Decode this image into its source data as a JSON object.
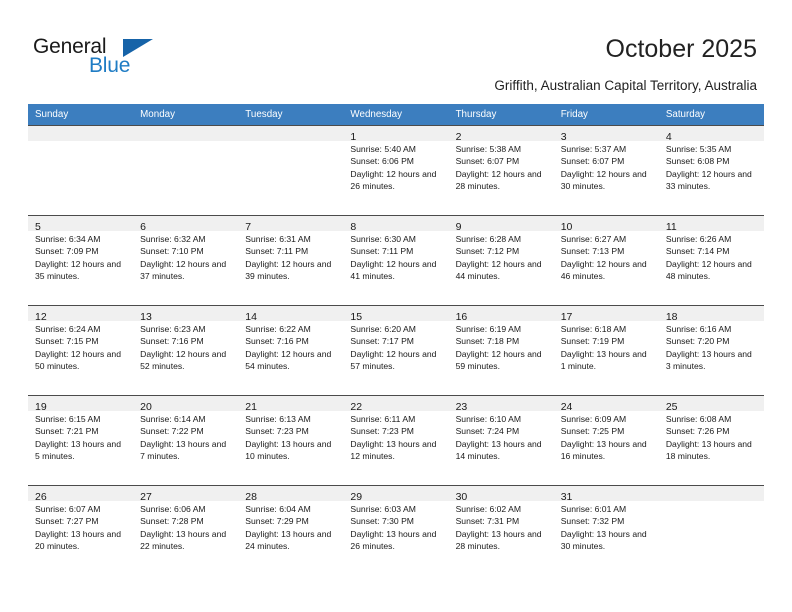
{
  "logo": {
    "line1": "General",
    "line2": "Blue",
    "triangle_icon": "blue-triangle-icon",
    "brand_color": "#1f7cc4",
    "triangle_color": "#1663a8"
  },
  "header": {
    "title": "October 2025",
    "subtitle": "Griffith, Australian Capital Territory, Australia"
  },
  "calendar": {
    "header_background": "#3c7ebf",
    "weekday_headers": [
      "Sunday",
      "Monday",
      "Tuesday",
      "Wednesday",
      "Thursday",
      "Friday",
      "Saturday"
    ],
    "weeks": [
      [
        {
          "day": "",
          "sunrise": "",
          "sunset": "",
          "daylight": "",
          "empty": true
        },
        {
          "day": "",
          "sunrise": "",
          "sunset": "",
          "daylight": "",
          "empty": true
        },
        {
          "day": "",
          "sunrise": "",
          "sunset": "",
          "daylight": "",
          "empty": true
        },
        {
          "day": "1",
          "sunrise": "Sunrise: 5:40 AM",
          "sunset": "Sunset: 6:06 PM",
          "daylight": "Daylight: 12 hours and 26 minutes.",
          "empty": false
        },
        {
          "day": "2",
          "sunrise": "Sunrise: 5:38 AM",
          "sunset": "Sunset: 6:07 PM",
          "daylight": "Daylight: 12 hours and 28 minutes.",
          "empty": false
        },
        {
          "day": "3",
          "sunrise": "Sunrise: 5:37 AM",
          "sunset": "Sunset: 6:07 PM",
          "daylight": "Daylight: 12 hours and 30 minutes.",
          "empty": false
        },
        {
          "day": "4",
          "sunrise": "Sunrise: 5:35 AM",
          "sunset": "Sunset: 6:08 PM",
          "daylight": "Daylight: 12 hours and 33 minutes.",
          "empty": false
        }
      ],
      [
        {
          "day": "5",
          "sunrise": "Sunrise: 6:34 AM",
          "sunset": "Sunset: 7:09 PM",
          "daylight": "Daylight: 12 hours and 35 minutes.",
          "empty": false
        },
        {
          "day": "6",
          "sunrise": "Sunrise: 6:32 AM",
          "sunset": "Sunset: 7:10 PM",
          "daylight": "Daylight: 12 hours and 37 minutes.",
          "empty": false
        },
        {
          "day": "7",
          "sunrise": "Sunrise: 6:31 AM",
          "sunset": "Sunset: 7:11 PM",
          "daylight": "Daylight: 12 hours and 39 minutes.",
          "empty": false
        },
        {
          "day": "8",
          "sunrise": "Sunrise: 6:30 AM",
          "sunset": "Sunset: 7:11 PM",
          "daylight": "Daylight: 12 hours and 41 minutes.",
          "empty": false
        },
        {
          "day": "9",
          "sunrise": "Sunrise: 6:28 AM",
          "sunset": "Sunset: 7:12 PM",
          "daylight": "Daylight: 12 hours and 44 minutes.",
          "empty": false
        },
        {
          "day": "10",
          "sunrise": "Sunrise: 6:27 AM",
          "sunset": "Sunset: 7:13 PM",
          "daylight": "Daylight: 12 hours and 46 minutes.",
          "empty": false
        },
        {
          "day": "11",
          "sunrise": "Sunrise: 6:26 AM",
          "sunset": "Sunset: 7:14 PM",
          "daylight": "Daylight: 12 hours and 48 minutes.",
          "empty": false
        }
      ],
      [
        {
          "day": "12",
          "sunrise": "Sunrise: 6:24 AM",
          "sunset": "Sunset: 7:15 PM",
          "daylight": "Daylight: 12 hours and 50 minutes.",
          "empty": false
        },
        {
          "day": "13",
          "sunrise": "Sunrise: 6:23 AM",
          "sunset": "Sunset: 7:16 PM",
          "daylight": "Daylight: 12 hours and 52 minutes.",
          "empty": false
        },
        {
          "day": "14",
          "sunrise": "Sunrise: 6:22 AM",
          "sunset": "Sunset: 7:16 PM",
          "daylight": "Daylight: 12 hours and 54 minutes.",
          "empty": false
        },
        {
          "day": "15",
          "sunrise": "Sunrise: 6:20 AM",
          "sunset": "Sunset: 7:17 PM",
          "daylight": "Daylight: 12 hours and 57 minutes.",
          "empty": false
        },
        {
          "day": "16",
          "sunrise": "Sunrise: 6:19 AM",
          "sunset": "Sunset: 7:18 PM",
          "daylight": "Daylight: 12 hours and 59 minutes.",
          "empty": false
        },
        {
          "day": "17",
          "sunrise": "Sunrise: 6:18 AM",
          "sunset": "Sunset: 7:19 PM",
          "daylight": "Daylight: 13 hours and 1 minute.",
          "empty": false
        },
        {
          "day": "18",
          "sunrise": "Sunrise: 6:16 AM",
          "sunset": "Sunset: 7:20 PM",
          "daylight": "Daylight: 13 hours and 3 minutes.",
          "empty": false
        }
      ],
      [
        {
          "day": "19",
          "sunrise": "Sunrise: 6:15 AM",
          "sunset": "Sunset: 7:21 PM",
          "daylight": "Daylight: 13 hours and 5 minutes.",
          "empty": false
        },
        {
          "day": "20",
          "sunrise": "Sunrise: 6:14 AM",
          "sunset": "Sunset: 7:22 PM",
          "daylight": "Daylight: 13 hours and 7 minutes.",
          "empty": false
        },
        {
          "day": "21",
          "sunrise": "Sunrise: 6:13 AM",
          "sunset": "Sunset: 7:23 PM",
          "daylight": "Daylight: 13 hours and 10 minutes.",
          "empty": false
        },
        {
          "day": "22",
          "sunrise": "Sunrise: 6:11 AM",
          "sunset": "Sunset: 7:23 PM",
          "daylight": "Daylight: 13 hours and 12 minutes.",
          "empty": false
        },
        {
          "day": "23",
          "sunrise": "Sunrise: 6:10 AM",
          "sunset": "Sunset: 7:24 PM",
          "daylight": "Daylight: 13 hours and 14 minutes.",
          "empty": false
        },
        {
          "day": "24",
          "sunrise": "Sunrise: 6:09 AM",
          "sunset": "Sunset: 7:25 PM",
          "daylight": "Daylight: 13 hours and 16 minutes.",
          "empty": false
        },
        {
          "day": "25",
          "sunrise": "Sunrise: 6:08 AM",
          "sunset": "Sunset: 7:26 PM",
          "daylight": "Daylight: 13 hours and 18 minutes.",
          "empty": false
        }
      ],
      [
        {
          "day": "26",
          "sunrise": "Sunrise: 6:07 AM",
          "sunset": "Sunset: 7:27 PM",
          "daylight": "Daylight: 13 hours and 20 minutes.",
          "empty": false
        },
        {
          "day": "27",
          "sunrise": "Sunrise: 6:06 AM",
          "sunset": "Sunset: 7:28 PM",
          "daylight": "Daylight: 13 hours and 22 minutes.",
          "empty": false
        },
        {
          "day": "28",
          "sunrise": "Sunrise: 6:04 AM",
          "sunset": "Sunset: 7:29 PM",
          "daylight": "Daylight: 13 hours and 24 minutes.",
          "empty": false
        },
        {
          "day": "29",
          "sunrise": "Sunrise: 6:03 AM",
          "sunset": "Sunset: 7:30 PM",
          "daylight": "Daylight: 13 hours and 26 minutes.",
          "empty": false
        },
        {
          "day": "30",
          "sunrise": "Sunrise: 6:02 AM",
          "sunset": "Sunset: 7:31 PM",
          "daylight": "Daylight: 13 hours and 28 minutes.",
          "empty": false
        },
        {
          "day": "31",
          "sunrise": "Sunrise: 6:01 AM",
          "sunset": "Sunset: 7:32 PM",
          "daylight": "Daylight: 13 hours and 30 minutes.",
          "empty": false
        },
        {
          "day": "",
          "sunrise": "",
          "sunset": "",
          "daylight": "",
          "empty": true
        }
      ]
    ]
  }
}
